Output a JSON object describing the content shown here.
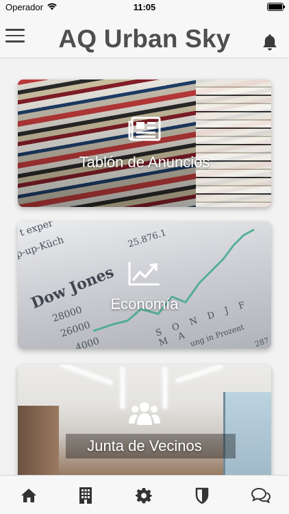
{
  "status_bar": {
    "carrier": "Operador",
    "time": "11:05"
  },
  "header": {
    "title": "AQ Urban Sky",
    "menu_icon": "hamburger-menu-icon",
    "notification_icon": "bell-icon"
  },
  "cards": [
    {
      "label": "Tablón de Anuncios",
      "icon": "newspaper-icon"
    },
    {
      "label": "Economía",
      "icon": "trending-up-icon"
    },
    {
      "label": "Junta de Vecinos",
      "icon": "users-group-icon"
    }
  ],
  "economy_image_text": {
    "dow_jones": "Dow Jones",
    "value_28000": "28000",
    "value_26000": "26000",
    "value_4000": "4000",
    "value_25876": "25.876.1",
    "months": "S O N D J F M A",
    "up_kuech": "p-up-Küch",
    "exper": "t exper",
    "prozent": "ung in Prozent",
    "num_287": "287"
  },
  "tab_bar": {
    "tabs": [
      "home-icon",
      "building-icon",
      "settings-gear-icon",
      "shield-icon",
      "chat-bubbles-icon"
    ]
  },
  "colors": {
    "title": "#4e4e4e",
    "icon": "#333333",
    "header_bg": "#f7f7f7"
  }
}
